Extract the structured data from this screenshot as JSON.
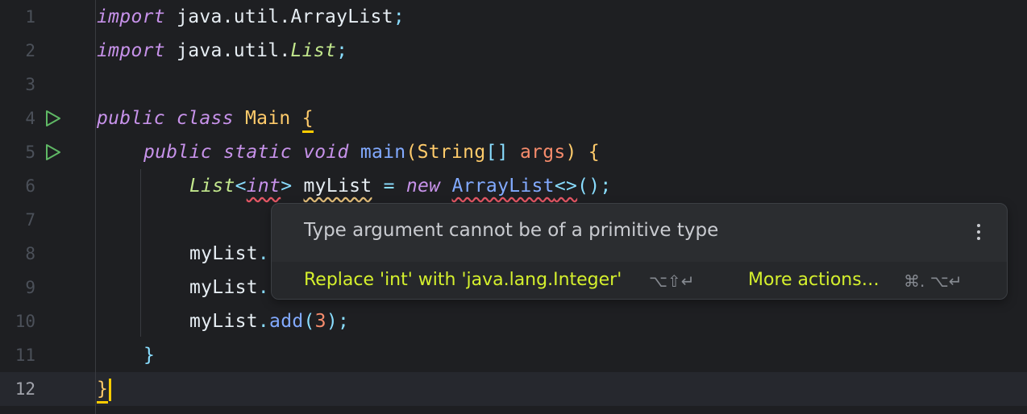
{
  "editor": {
    "line_numbers": [
      "1",
      "2",
      "3",
      "4",
      "5",
      "6",
      "7",
      "8",
      "9",
      "10",
      "11",
      "12"
    ],
    "lines": {
      "l1": {
        "kw": "import",
        "rest": "java.util.ArrayList",
        "semi": ";"
      },
      "l2": {
        "kw": "import",
        "pkg": "java.util.",
        "type": "List",
        "semi": ";"
      },
      "l4": {
        "kw1": "public",
        "kw2": "class",
        "name": "Main",
        "brace": "{"
      },
      "l5": {
        "kw1": "public",
        "kw2": "static",
        "kw3": "void",
        "fn": "main",
        "open": "(",
        "type": "String",
        "arr": "[]",
        "param": "args",
        "close": ")",
        "brace": "{"
      },
      "l6": {
        "type": "List",
        "lt": "<",
        "prim": "int",
        "gt": ">",
        "var": "myList",
        "eq": "=",
        "kw": "new",
        "cls": "ArrayList",
        "diamond": "<>",
        "call": "();"
      },
      "l8": {
        "var": "myList",
        "dot": "."
      },
      "l9": {
        "var": "myList",
        "dot": "."
      },
      "l10": {
        "var": "myList",
        "dot": ".",
        "fn": "add",
        "open": "(",
        "num": "3",
        "close": ");"
      },
      "l11": {
        "brace": "}"
      },
      "l12": {
        "brace": "}"
      }
    }
  },
  "popup": {
    "message": "Type argument cannot be of a primitive type",
    "fix_label": "Replace 'int' with 'java.lang.Integer'",
    "fix_shortcut": "⌥⇧↵",
    "more_label": "More actions…",
    "more_shortcut": "⌘. ⌥↵"
  },
  "colors": {
    "background": "#1e1f22",
    "keyword": "#c792ea",
    "class_name": "#ffcb6b",
    "type": "#c3e88d",
    "function": "#82aaff",
    "param": "#f78c6c",
    "action": "#d5f02d",
    "error_underline": "#e55765"
  },
  "icons": {
    "run_gutter": "run-triangle-icon",
    "popup_menu": "kebab-menu-icon"
  }
}
